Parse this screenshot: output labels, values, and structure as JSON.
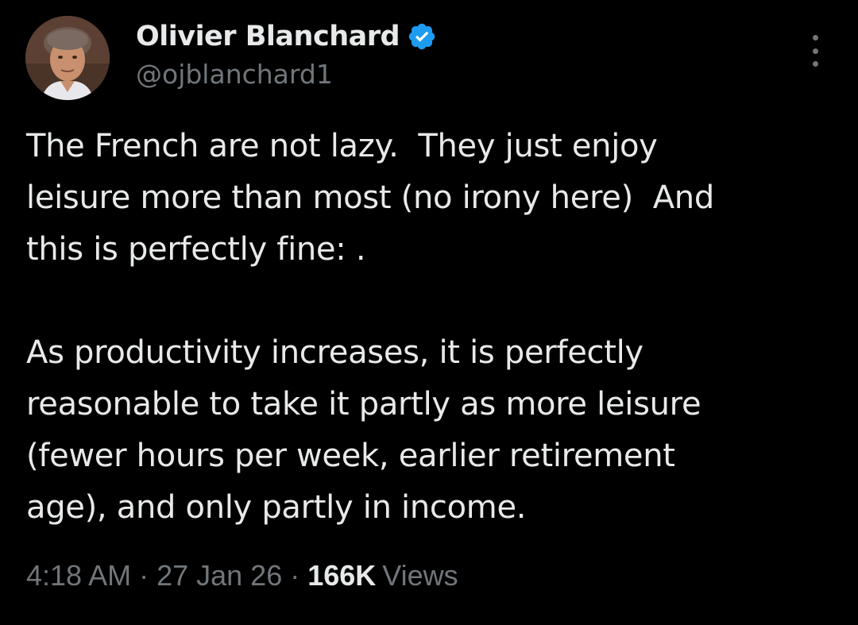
{
  "author": {
    "display_name": "Olivier Blanchard",
    "handle": "@ojblanchard1",
    "verified": true,
    "verified_icon": "verified-badge-icon",
    "verified_color": "#1d9bf0"
  },
  "tweet": {
    "lines_p1": [
      "The French are not lazy.  They just enjoy",
      "leisure more than most (no irony here)  And",
      "this is perfectly fine: ."
    ],
    "lines_p2": [
      "As productivity increases, it is perfectly",
      "reasonable to take it partly as more leisure",
      "(fewer hours per week, earlier retirement",
      "age), and only partly in income."
    ]
  },
  "meta": {
    "time": "4:18 AM",
    "separator": "·",
    "date": "27 Jan 26",
    "views_count": "166K",
    "views_label": "Views"
  },
  "colors": {
    "background": "#000000",
    "primary_text": "#e7e9ea",
    "secondary_text": "#71767b"
  },
  "icons": {
    "more": "more-options-icon",
    "avatar": "avatar"
  }
}
